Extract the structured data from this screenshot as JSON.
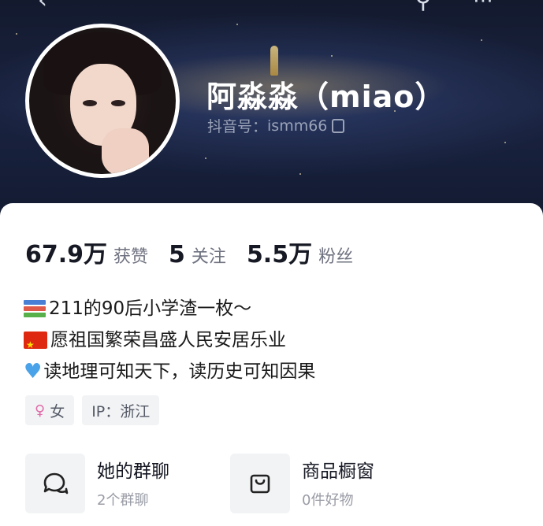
{
  "profile": {
    "display_name": "阿淼淼（miao）",
    "douyin_id_label": "抖音号：",
    "douyin_id": "ismm66"
  },
  "stats": [
    {
      "number": "67.9万",
      "label": "获赞"
    },
    {
      "number": "5",
      "label": "关注"
    },
    {
      "number": "5.5万",
      "label": "粉丝"
    }
  ],
  "bio": [
    {
      "icon": "books-icon",
      "text": "211的90后小学渣一枚～"
    },
    {
      "icon": "china-flag-icon",
      "text": "愿祖国繁荣昌盛人民安居乐业"
    },
    {
      "icon": "blue-heart-icon",
      "text": "读地理可知天下，读历史可知因果"
    }
  ],
  "tags": {
    "gender": "女",
    "ip": "IP：浙江"
  },
  "quick_links": [
    {
      "icon": "chat-bubbles-icon",
      "title": "她的群聊",
      "subtitle": "2个群聊"
    },
    {
      "icon": "shopping-bag-icon",
      "title": "商品橱窗",
      "subtitle": "0件好物"
    }
  ],
  "colors": {
    "banner": "#131a2e",
    "card": "#ffffff",
    "female_tag": "#e06aa9"
  }
}
